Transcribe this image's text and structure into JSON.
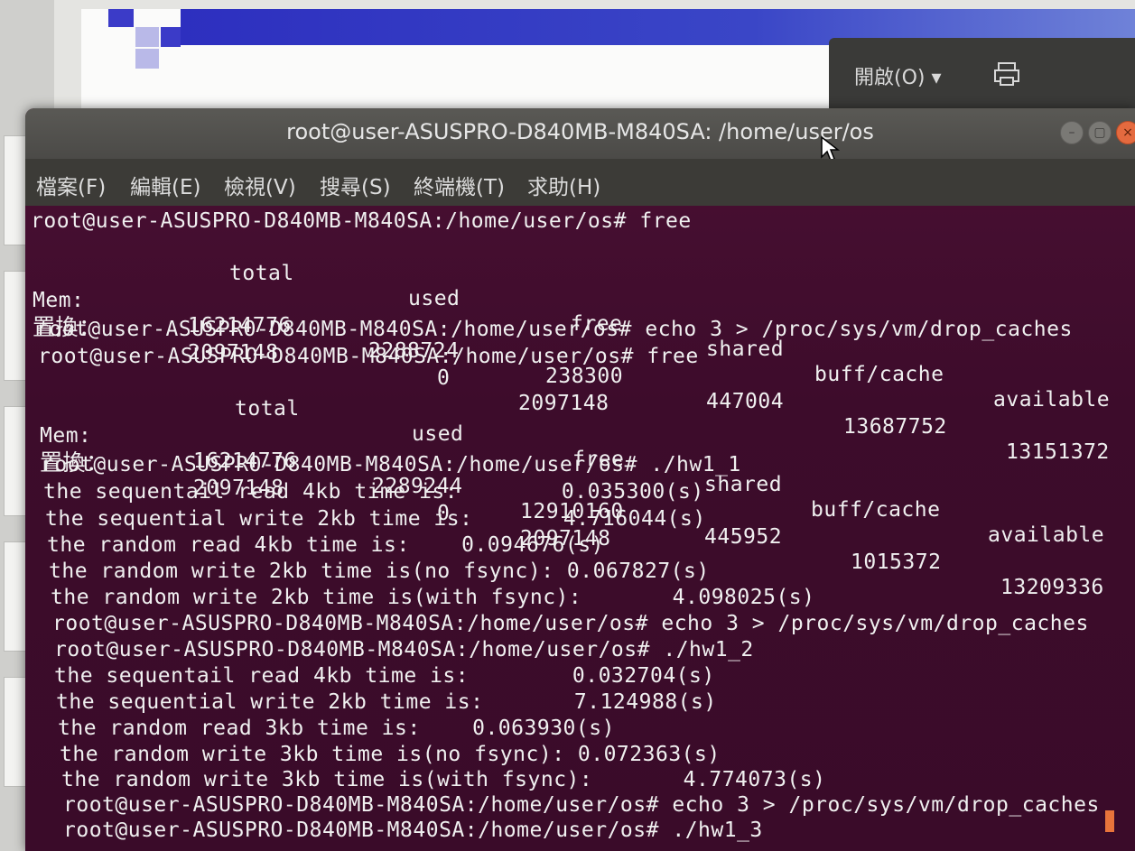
{
  "background_app": {
    "open_button_label": "開啟(O) ▾",
    "print_icon": "print-icon"
  },
  "terminal": {
    "title": "root@user-ASUSPRO-D840MB-M840SA: /home/user/os",
    "menu": [
      "檔案(F)",
      "編輯(E)",
      "檢視(V)",
      "搜尋(S)",
      "終端機(T)",
      "求助(H)"
    ],
    "prompt": "root@user-ASUSPRO-D840MB-M840SA:/home/user/os#",
    "commands": {
      "free": "free",
      "drop": "echo 3 > /proc/sys/vm/drop_caches",
      "hw1_1": "./hw1_1",
      "hw1_2": "./hw1_2",
      "hw1_3": "./hw1_3"
    },
    "free_headers": [
      "total",
      "used",
      "free",
      "shared",
      "buff/cache",
      "available"
    ],
    "free_1": {
      "mem": [
        "Mem:",
        "16214776",
        "2288724",
        "238300",
        "447004",
        "13687752",
        "13151372"
      ],
      "swap": [
        "置換：",
        "2097148",
        "0",
        "2097148"
      ]
    },
    "free_2": {
      "mem": [
        "Mem:",
        "16214776",
        "2289244",
        "12910160",
        "445952",
        "1015372",
        "13209336"
      ],
      "swap": [
        "置換：",
        "2097148",
        "0",
        "2097148"
      ]
    },
    "hw1_1_output": [
      "the sequentail read 4kb time is:        0.035300(s)",
      "the sequential write 2kb time is:       4.716044(s)",
      "the random read 4kb time is:    0.094676(s)",
      "the random write 2kb time is(no fsync): 0.067827(s)",
      "the random write 2kb time is(with fsync):       4.098025(s)"
    ],
    "hw1_2_output": [
      "the sequentail read 4kb time is:        0.032704(s)",
      "the sequential write 2kb time is:       7.124988(s)",
      "the random read 3kb time is:    0.063930(s)",
      "the random write 3kb time is(no fsync): 0.072363(s)",
      "the random write 3kb time is(with fsync):       4.774073(s)"
    ]
  }
}
